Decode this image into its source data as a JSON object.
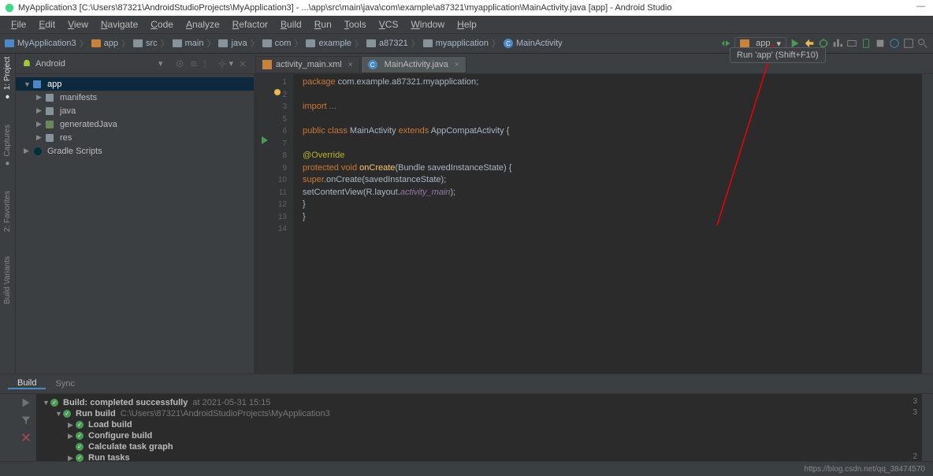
{
  "title": "MyApplication3 [C:\\Users\\87321\\AndroidStudioProjects\\MyApplication3] - ...\\app\\src\\main\\java\\com\\example\\a87321\\myapplication\\MainActivity.java [app] - Android Studio",
  "menu": [
    "File",
    "Edit",
    "View",
    "Navigate",
    "Code",
    "Analyze",
    "Refactor",
    "Build",
    "Run",
    "Tools",
    "VCS",
    "Window",
    "Help"
  ],
  "breadcrumb": [
    "MyApplication3",
    "app",
    "src",
    "main",
    "java",
    "com",
    "example",
    "a87321",
    "myapplication",
    "MainActivity"
  ],
  "run_config": "app",
  "tooltip": "Run 'app' (Shift+F10)",
  "project_panel": {
    "mode": "Android",
    "tree": [
      {
        "label": "app",
        "depth": 0,
        "icon": "module",
        "expanded": true,
        "selected": true
      },
      {
        "label": "manifests",
        "depth": 1,
        "icon": "folder",
        "collapsed": true
      },
      {
        "label": "java",
        "depth": 1,
        "icon": "folder",
        "collapsed": true
      },
      {
        "label": "generatedJava",
        "depth": 1,
        "icon": "gen",
        "collapsed": true
      },
      {
        "label": "res",
        "depth": 1,
        "icon": "folder",
        "collapsed": true
      },
      {
        "label": "Gradle Scripts",
        "depth": 0,
        "icon": "gradle",
        "collapsed": true
      }
    ]
  },
  "tabs": [
    {
      "label": "activity_main.xml",
      "icon": "xml",
      "active": false
    },
    {
      "label": "MainActivity.java",
      "icon": "class",
      "active": true
    }
  ],
  "code_lines": [
    {
      "n": 1,
      "html": "<span class='kw'>package</span> com.example.a87321.myapplication;"
    },
    {
      "n": 2,
      "html": ""
    },
    {
      "n": 3,
      "html": "<span class='kw'>import</span> <span class='cm'>...</span>"
    },
    {
      "n": 5,
      "html": ""
    },
    {
      "n": 6,
      "html": "<span class='kw'>public class</span> <span class='cls'>MainActivity</span> <span class='kw'>extends</span> AppCompatActivity {"
    },
    {
      "n": 7,
      "html": ""
    },
    {
      "n": 8,
      "html": "    <span class='ann'>@Override</span>"
    },
    {
      "n": 9,
      "html": "    <span class='kw'>protected void</span> <span class='fn'>onCreate</span>(Bundle savedInstanceState) {"
    },
    {
      "n": 10,
      "html": "        <span class='kw'>super</span>.onCreate(savedInstanceState);"
    },
    {
      "n": 11,
      "html": "        setContentView(R.layout.<span class='it'>activity_main</span>);"
    },
    {
      "n": 12,
      "html": "    }"
    },
    {
      "n": 13,
      "html": "}"
    },
    {
      "n": 14,
      "html": ""
    }
  ],
  "bottom_tabs": [
    "Build",
    "Sync"
  ],
  "build": {
    "rows": [
      {
        "depth": 0,
        "arrow": "▼",
        "status": "ok",
        "text": "Build:",
        "bold": "completed successfully",
        "dim": "at 2021-05-31 15:15"
      },
      {
        "depth": 1,
        "arrow": "▼",
        "status": "ok",
        "text": "Run build",
        "dim": "C:\\Users\\87321\\AndroidStudioProjects\\MyApplication3"
      },
      {
        "depth": 2,
        "arrow": "▶",
        "status": "ok",
        "text": "Load build"
      },
      {
        "depth": 2,
        "arrow": "▶",
        "status": "ok",
        "text": "Configure build"
      },
      {
        "depth": 2,
        "arrow": "",
        "status": "ok",
        "text": "Calculate task graph"
      },
      {
        "depth": 2,
        "arrow": "▶",
        "status": "ok",
        "text": "Run tasks"
      }
    ],
    "durations": [
      "3",
      "3",
      "",
      "",
      "",
      "2"
    ]
  },
  "status_url": "https://blog.csdn.net/qq_38474570",
  "left_tools": [
    "1: Project",
    "Captures",
    "2: Favorites",
    "Build Variants"
  ]
}
